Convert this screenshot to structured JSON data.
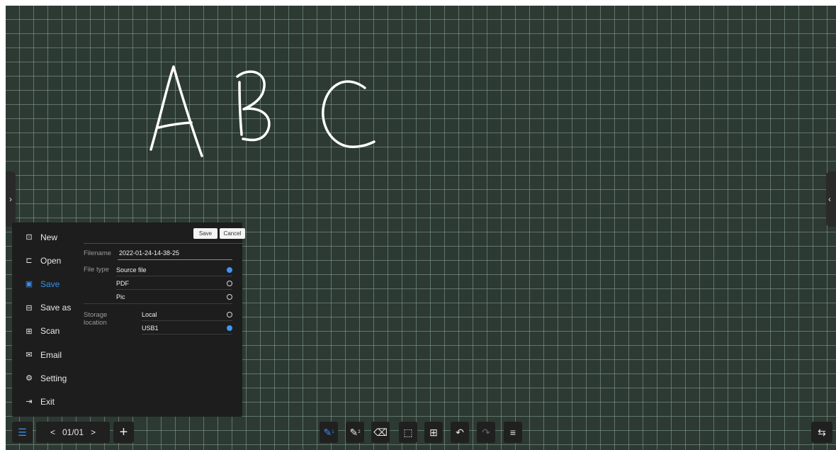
{
  "board": {
    "ink_text": "ABC",
    "grid_color": "#2c3a33"
  },
  "edges": {
    "left_handle_icon": "›",
    "right_handle_icon": "‹"
  },
  "menu": {
    "items": [
      {
        "label": "New",
        "icon": "new-file-icon",
        "glyph": "⊡"
      },
      {
        "label": "Open",
        "icon": "folder-open-icon",
        "glyph": "⊏"
      },
      {
        "label": "Save",
        "icon": "save-icon",
        "glyph": "▣",
        "active": true
      },
      {
        "label": "Save as",
        "icon": "save-as-icon",
        "glyph": "⊟"
      },
      {
        "label": "Scan",
        "icon": "qr-scan-icon",
        "glyph": "⊞"
      },
      {
        "label": "Email",
        "icon": "email-icon",
        "glyph": "✉"
      },
      {
        "label": "Setting",
        "icon": "gear-icon",
        "glyph": "⚙"
      },
      {
        "label": "Exit",
        "icon": "exit-icon",
        "glyph": "⇥"
      }
    ]
  },
  "save_form": {
    "save_label": "Save",
    "cancel_label": "Cancel",
    "filename_label": "Filename",
    "filename_value": "2022-01-24-14-38-25",
    "filetype_label": "File type",
    "filetype_options": [
      "Source file",
      "PDF",
      "Pic"
    ],
    "filetype_selected": "Source file",
    "storage_label_1": "Storage",
    "storage_label_2": "location",
    "storage_options": [
      "Local",
      "USB1"
    ],
    "storage_selected": "USB1",
    "accent": "#3e95f0"
  },
  "toolbar": {
    "page_indicator": "01/01",
    "prev_icon": "<",
    "next_icon": ">",
    "add_icon": "+",
    "tools": [
      {
        "icon": "pen-1-icon",
        "glyph": "✎",
        "sub": "1",
        "active": true
      },
      {
        "icon": "pen-2-icon",
        "glyph": "✎",
        "sub": "2"
      },
      {
        "icon": "eraser-icon",
        "glyph": "⌫"
      },
      {
        "icon": "lasso-select-icon",
        "glyph": "⬚"
      },
      {
        "icon": "insert-icon",
        "glyph": "⊞"
      },
      {
        "icon": "undo-icon",
        "glyph": "↶"
      },
      {
        "icon": "redo-icon",
        "glyph": "↷",
        "disabled": true
      },
      {
        "icon": "more-menu-icon",
        "glyph": "≡"
      }
    ],
    "switch_icon": "⇆"
  }
}
